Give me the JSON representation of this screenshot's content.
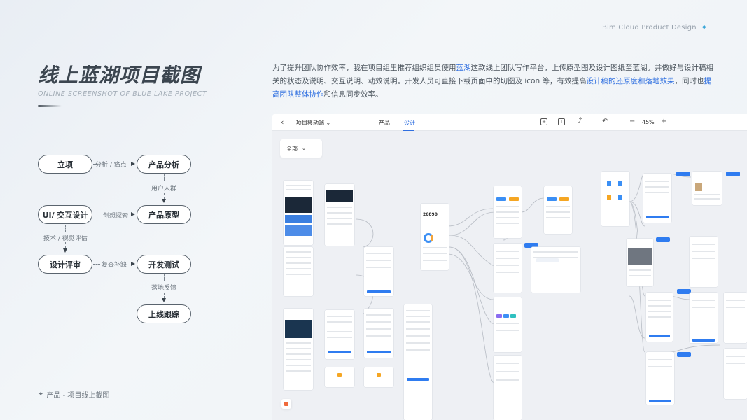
{
  "brand": {
    "text": "Bim Cloud Product Design",
    "icon": "sparkle-icon"
  },
  "header": {
    "title": "线上蓝湖项目截图",
    "subtitle": "ONLINE SCREENSHOT OF BLUE LAKE PROJECT"
  },
  "description": {
    "p1": "为了提升团队协作效率，我在项目组里推荐组织组员使用",
    "h1": "蓝湖",
    "p2": "这款线上团队写作平台，上传原型图及设计图纸至蓝湖。并做好与设计稿相关的状态及说明、交互说明、动效说明。开发人员可直接下载页面中的切图及 icon 等，有效提高",
    "h2": "设计稿的还原度和落地效果",
    "p3": "，同时也",
    "h3": "提高团队整体协作",
    "p4": "和信息同步效率。",
    "highlight_color": "#2f6fe0"
  },
  "flow": {
    "nodes": {
      "start": "立项",
      "analysis": "产品分析",
      "ui": "UI/ 交互设计",
      "prototype": "产品原型",
      "review": "设计评审",
      "dev": "开发测试",
      "launch": "上线跟踪"
    },
    "labels": {
      "a1": "分析 / 痛点",
      "a2": "用户人群",
      "a3": "创想探索",
      "a4": "技术 / 视觉评估",
      "a5": "复查补缺",
      "a6": "落地反馈"
    }
  },
  "caption": {
    "icon": "sparkle-icon",
    "text": "产品 - 项目线上截图"
  },
  "screenshot": {
    "toolbar": {
      "project": "项目移动端",
      "tabs": [
        "产品",
        "设计"
      ],
      "active_tab": "设计",
      "zoom": "45%",
      "minus": "−",
      "plus": "+"
    },
    "filter": "全部",
    "stat_value": "26890"
  }
}
